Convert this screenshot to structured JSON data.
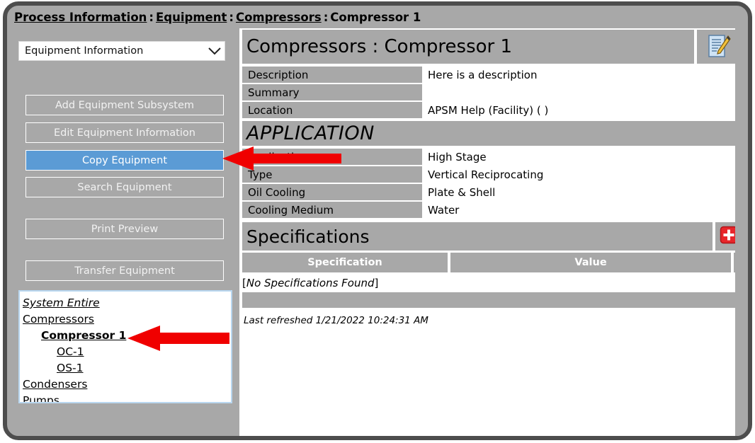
{
  "breadcrumb": {
    "items": [
      {
        "label": "Process Information",
        "link": true
      },
      {
        "label": "Equipment",
        "link": true
      },
      {
        "label": "Compressors",
        "link": true
      },
      {
        "label": "Compressor 1",
        "link": false
      }
    ],
    "separator": ":"
  },
  "sidebar": {
    "dropdown": {
      "value": "Equipment Information",
      "icon": "chevron-down-icon"
    },
    "buttons": [
      {
        "label": "Add Equipment Subsystem",
        "selected": false
      },
      {
        "label": "Edit Equipment Information",
        "selected": false
      },
      {
        "label": "Copy Equipment",
        "selected": true
      },
      {
        "label": "Search Equipment",
        "selected": false
      },
      {
        "label": "Print Preview",
        "selected": false
      },
      {
        "label": "Transfer Equipment",
        "selected": false
      }
    ],
    "tree": [
      {
        "label": "System Entire",
        "level": 1,
        "italic": true,
        "bold": false
      },
      {
        "label": "Compressors",
        "level": 1,
        "italic": false,
        "bold": false
      },
      {
        "label": "Compressor 1",
        "level": 2,
        "italic": false,
        "bold": true
      },
      {
        "label": "OC-1",
        "level": 3,
        "italic": false,
        "bold": false
      },
      {
        "label": "OS-1",
        "level": 3,
        "italic": false,
        "bold": false
      },
      {
        "label": "Condensers",
        "level": 1,
        "italic": false,
        "bold": false
      },
      {
        "label": "Pumps",
        "level": 1,
        "italic": false,
        "bold": false
      }
    ]
  },
  "main": {
    "title": "Compressors : Compressor 1",
    "edit_icon": "edit-note-icon",
    "info_rows": [
      {
        "label": "Description",
        "value": "Here is a description"
      },
      {
        "label": "Summary",
        "value": ""
      },
      {
        "label": "Location",
        "value": "APSM Help (Facility) ( )"
      }
    ],
    "application_section": {
      "heading": "APPLICATION",
      "rows": [
        {
          "label": "Application",
          "value": "High Stage"
        },
        {
          "label": "Type",
          "value": "Vertical Reciprocating"
        },
        {
          "label": "Oil Cooling",
          "value": "Plate & Shell"
        },
        {
          "label": "Cooling Medium",
          "value": "Water"
        }
      ]
    },
    "specifications": {
      "heading": "Specifications",
      "add_icon": "add-plus-icon",
      "columns": [
        "Specification",
        "Value"
      ],
      "empty_message": "No Specifications Found",
      "rows": []
    },
    "last_refreshed": "Last refreshed 1/21/2022 10:24:31 AM"
  },
  "annotations": [
    {
      "name": "arrow-to-copy-equipment",
      "color": "#f00000"
    },
    {
      "name": "arrow-to-compressor-1",
      "color": "#f00000"
    }
  ],
  "colors": {
    "frame": "#4d4d4d",
    "page_background": "#a8a8a8",
    "panel_background": "#ffffff",
    "selected_button": "#5b9bd5",
    "annotation_red": "#f00000",
    "add_icon_red": "#e8262b",
    "tree_border": "#b9d7f0"
  }
}
